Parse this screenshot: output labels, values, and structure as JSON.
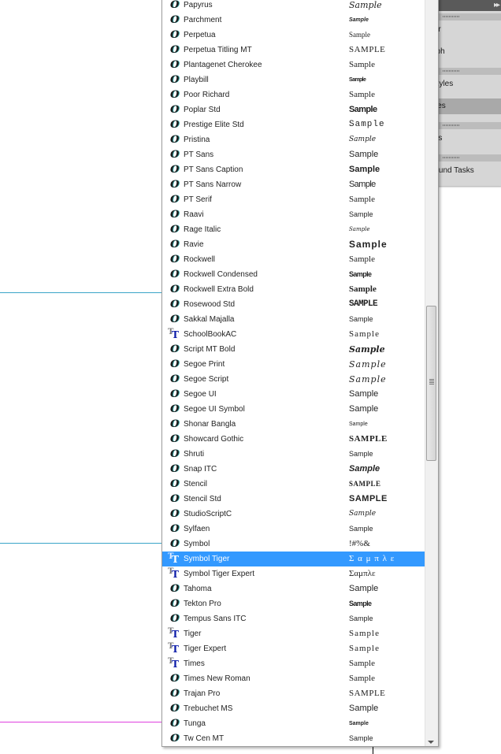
{
  "panels": {
    "items": [
      {
        "label": "ter",
        "active": false
      },
      {
        "label": "aph",
        "active": false
      },
      {
        "label": "Styles",
        "active": false
      },
      {
        "label": "yles",
        "active": true
      },
      {
        "label": "nts",
        "active": false
      },
      {
        "label": "round Tasks",
        "active": false
      }
    ]
  },
  "font_list": {
    "fonts": [
      {
        "name": "Papyrus",
        "sample": "Sample",
        "icon": "opentype-icon"
      },
      {
        "name": "Parchment",
        "sample": "Sample",
        "icon": "opentype-icon"
      },
      {
        "name": "Perpetua",
        "sample": "Sample",
        "icon": "opentype-icon"
      },
      {
        "name": "Perpetua Titling MT",
        "sample": "SAMPLE",
        "icon": "opentype-icon"
      },
      {
        "name": "Plantagenet Cherokee",
        "sample": "Sample",
        "icon": "opentype-icon"
      },
      {
        "name": "Playbill",
        "sample": "Sample",
        "icon": "opentype-icon"
      },
      {
        "name": "Poor Richard",
        "sample": "Sample",
        "icon": "opentype-icon"
      },
      {
        "name": "Poplar Std",
        "sample": "Sample",
        "icon": "opentype-icon"
      },
      {
        "name": "Prestige Elite Std",
        "sample": "Sample",
        "icon": "opentype-icon"
      },
      {
        "name": "Pristina",
        "sample": "Sample",
        "icon": "opentype-icon"
      },
      {
        "name": "PT Sans",
        "sample": "Sample",
        "icon": "opentype-icon"
      },
      {
        "name": "PT Sans Caption",
        "sample": "Sample",
        "icon": "opentype-icon"
      },
      {
        "name": "PT Sans Narrow",
        "sample": "Sample",
        "icon": "opentype-icon"
      },
      {
        "name": "PT Serif",
        "sample": "Sample",
        "icon": "opentype-icon"
      },
      {
        "name": "Raavi",
        "sample": "Sample",
        "icon": "opentype-icon"
      },
      {
        "name": "Rage Italic",
        "sample": "Sample",
        "icon": "opentype-icon"
      },
      {
        "name": "Ravie",
        "sample": "Sample",
        "icon": "opentype-icon"
      },
      {
        "name": "Rockwell",
        "sample": "Sample",
        "icon": "opentype-icon"
      },
      {
        "name": "Rockwell Condensed",
        "sample": "Sample",
        "icon": "opentype-icon"
      },
      {
        "name": "Rockwell Extra Bold",
        "sample": "Sample",
        "icon": "opentype-icon"
      },
      {
        "name": "Rosewood Std",
        "sample": "SAMPLE",
        "icon": "opentype-icon"
      },
      {
        "name": "Sakkal Majalla",
        "sample": "Sample",
        "icon": "opentype-icon"
      },
      {
        "name": "SchoolBookAC",
        "sample": "Sample",
        "icon": "truetype-icon"
      },
      {
        "name": "Script MT Bold",
        "sample": "Sample",
        "icon": "opentype-icon"
      },
      {
        "name": "Segoe Print",
        "sample": "Sample",
        "icon": "opentype-icon"
      },
      {
        "name": "Segoe Script",
        "sample": "Sample",
        "icon": "opentype-icon"
      },
      {
        "name": "Segoe UI",
        "sample": "Sample",
        "icon": "opentype-icon"
      },
      {
        "name": "Segoe UI Symbol",
        "sample": "Sample",
        "icon": "opentype-icon"
      },
      {
        "name": "Shonar Bangla",
        "sample": "Sample",
        "icon": "opentype-icon"
      },
      {
        "name": "Showcard Gothic",
        "sample": "SAMPLE",
        "icon": "opentype-icon"
      },
      {
        "name": "Shruti",
        "sample": "Sample",
        "icon": "opentype-icon"
      },
      {
        "name": "Snap ITC",
        "sample": "Sample",
        "icon": "opentype-icon"
      },
      {
        "name": "Stencil",
        "sample": "SAMPLE",
        "icon": "opentype-icon"
      },
      {
        "name": "Stencil Std",
        "sample": "SAMPLE",
        "icon": "opentype-icon"
      },
      {
        "name": "StudioScriptC",
        "sample": "Sample",
        "icon": "opentype-icon"
      },
      {
        "name": "Sylfaen",
        "sample": "Sample",
        "icon": "opentype-icon"
      },
      {
        "name": "Symbol",
        "sample": "!#%&",
        "icon": "opentype-icon"
      },
      {
        "name": "Symbol Tiger",
        "sample": "Σ α μ π λ ε",
        "icon": "truetype-icon",
        "selected": true
      },
      {
        "name": "Symbol Tiger Expert",
        "sample": "Σαμπλε",
        "icon": "truetype-icon"
      },
      {
        "name": "Tahoma",
        "sample": "Sample",
        "icon": "opentype-icon"
      },
      {
        "name": "Tekton Pro",
        "sample": "Sample",
        "icon": "opentype-icon"
      },
      {
        "name": "Tempus Sans ITC",
        "sample": "Sample",
        "icon": "opentype-icon"
      },
      {
        "name": "Tiger",
        "sample": "Sample",
        "icon": "truetype-icon"
      },
      {
        "name": "Tiger Expert",
        "sample": "Sample",
        "icon": "truetype-icon"
      },
      {
        "name": "Times",
        "sample": "Sample",
        "icon": "truetype-icon"
      },
      {
        "name": "Times New Roman",
        "sample": "Sample",
        "icon": "opentype-icon"
      },
      {
        "name": "Trajan Pro",
        "sample": "SAMPLE",
        "icon": "opentype-icon"
      },
      {
        "name": "Trebuchet MS",
        "sample": "Sample",
        "icon": "opentype-icon"
      },
      {
        "name": "Tunga",
        "sample": "Sample",
        "icon": "opentype-icon"
      },
      {
        "name": "Tw Cen MT",
        "sample": "Sample",
        "icon": "opentype-icon"
      }
    ]
  },
  "colors": {
    "selection": "#3399ff",
    "guide_teal": "#3aa5c8",
    "guide_magenta": "#e040e0",
    "truetype_icon": "#0a1aa8",
    "opentype_icon_accent": "#2ea3a3"
  }
}
